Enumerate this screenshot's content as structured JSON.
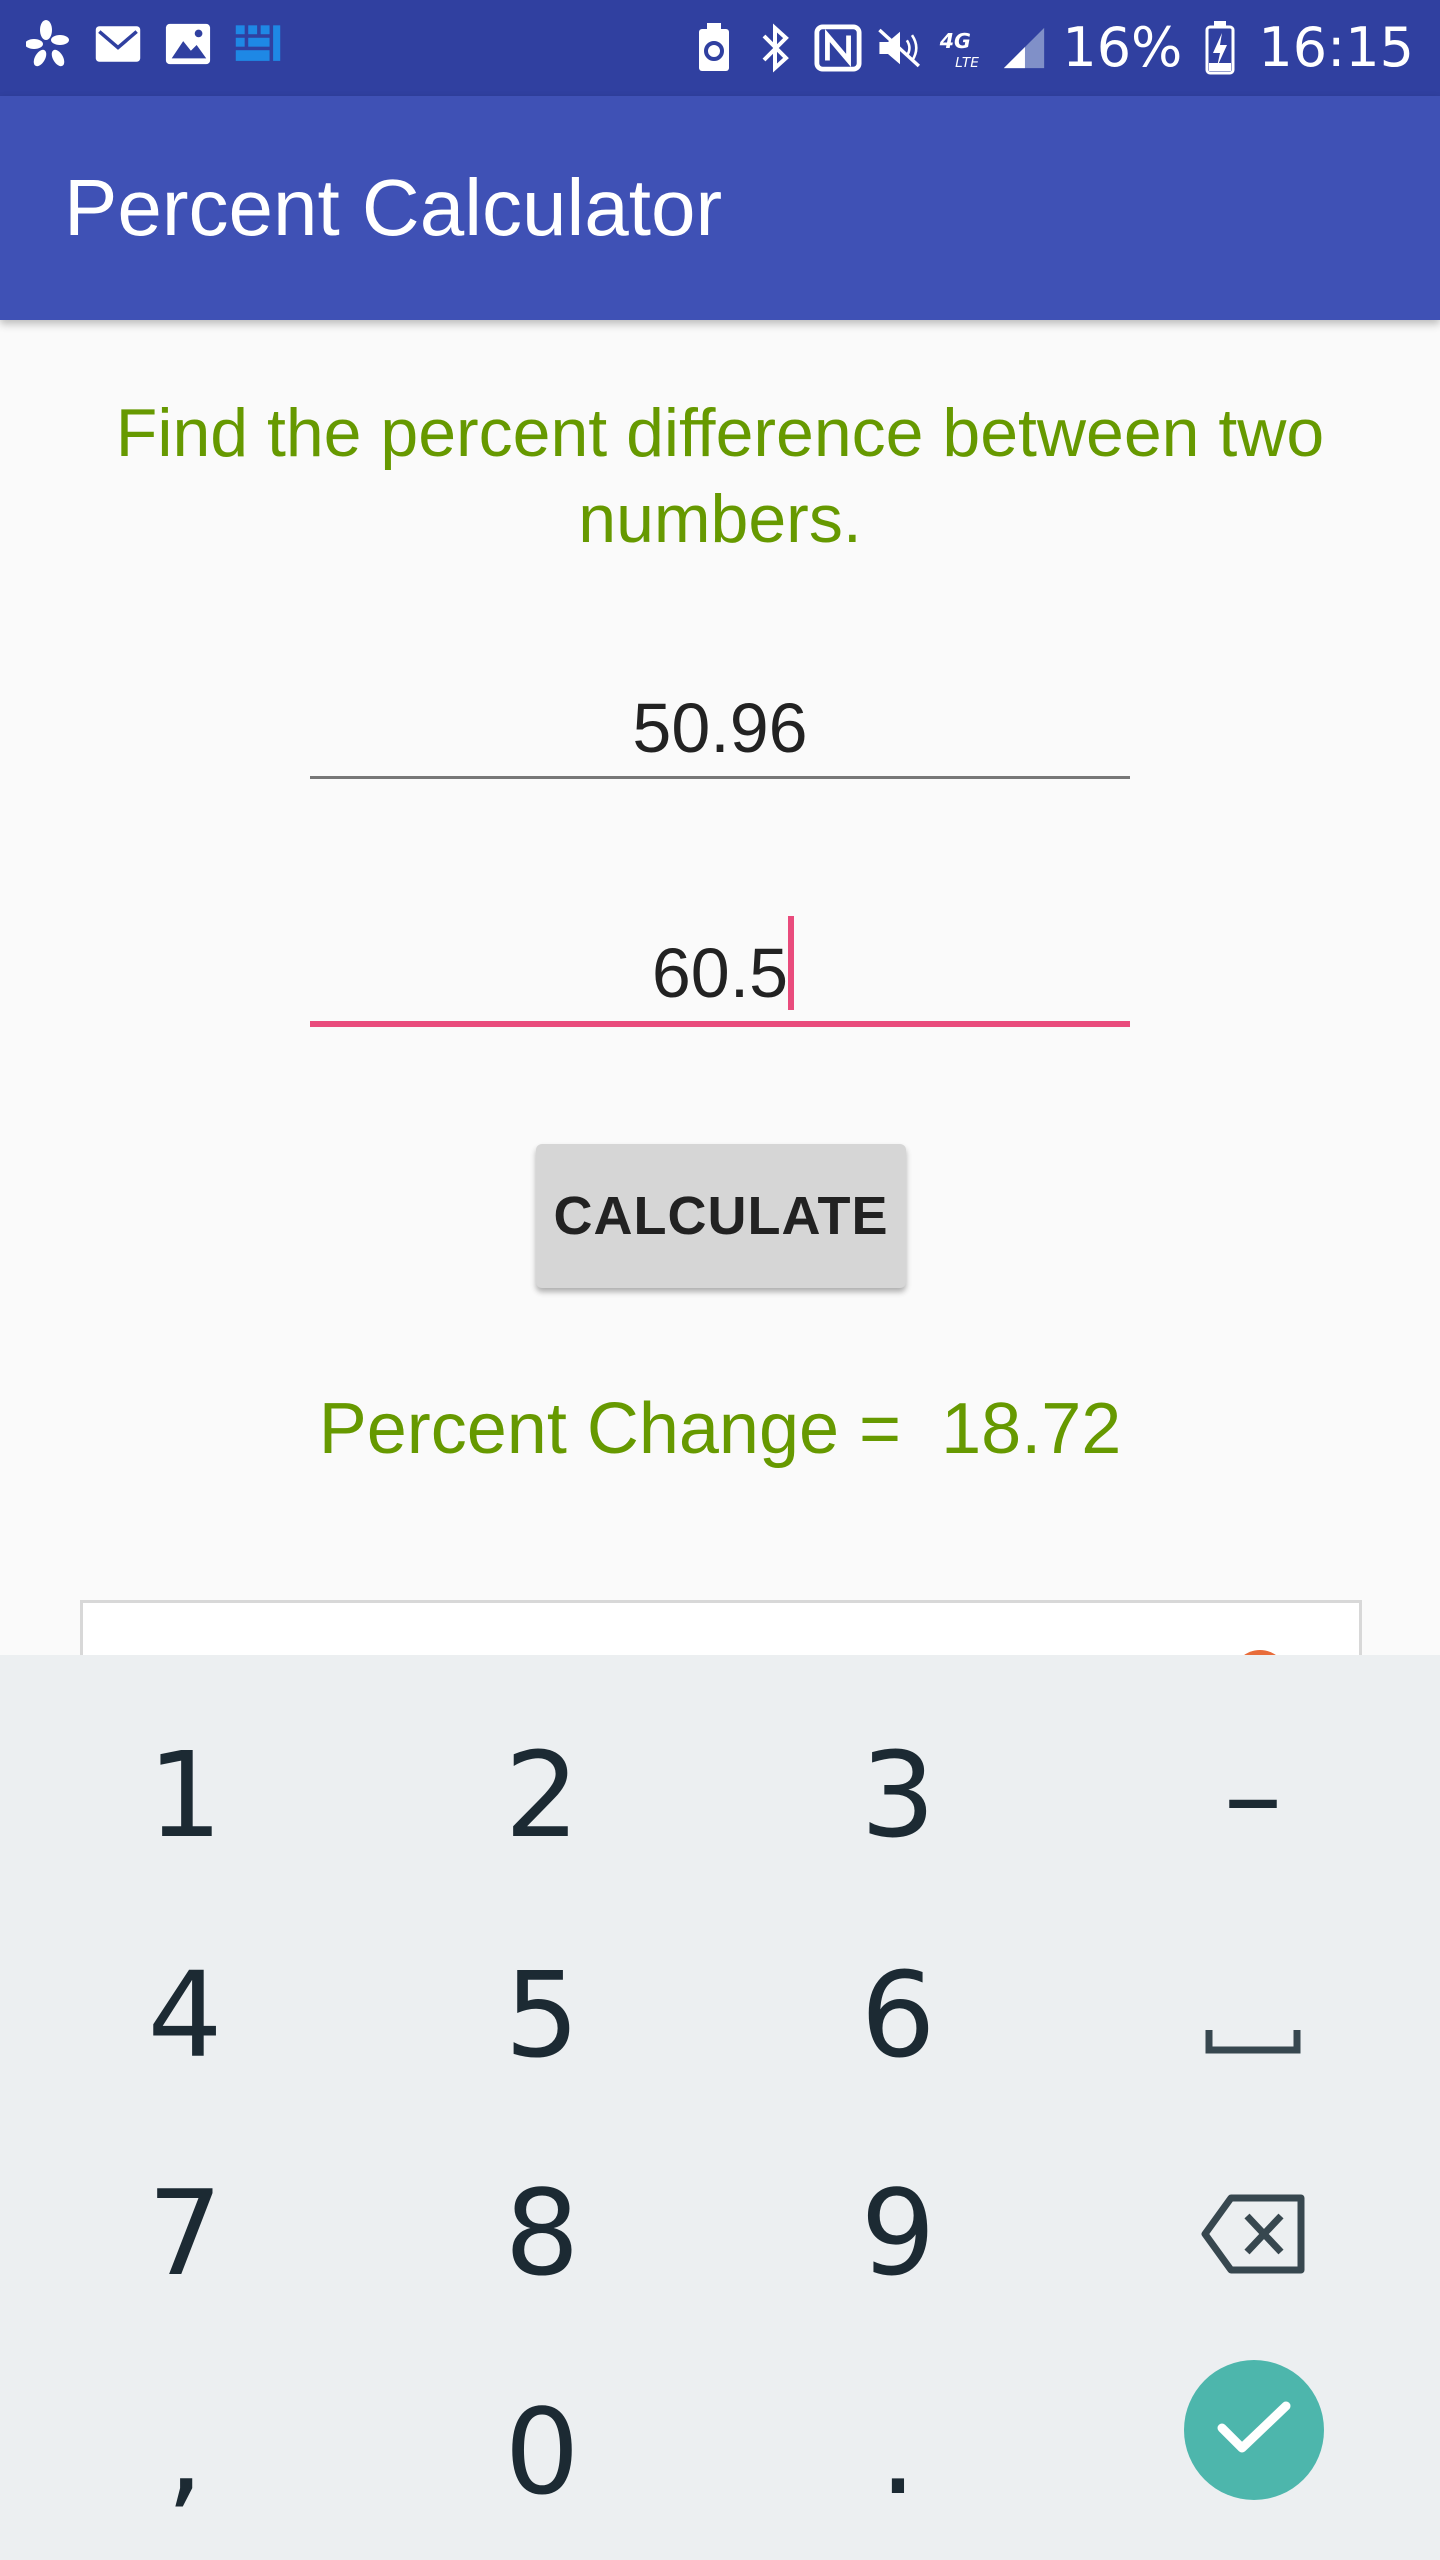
{
  "status_bar": {
    "battery_percent": "16%",
    "time": "16:15",
    "network_label": "4G LTE",
    "icons_left": [
      "yelp-icon",
      "mail-icon",
      "image-icon",
      "grid-app-icon"
    ],
    "icons_right": [
      "battery-saver-icon",
      "bluetooth-icon",
      "nfc-icon",
      "mute-icon",
      "signal-icon",
      "battery-charging-icon"
    ]
  },
  "app": {
    "title": "Percent Calculator",
    "theme_color": "#3f51b5",
    "accent_color": "#e94b7c",
    "text_accent_color": "#669900"
  },
  "main": {
    "headline": "Find the percent difference between two numbers.",
    "first_number": "50.96",
    "second_number": "60.5",
    "calculate_label": "CALCULATE",
    "result_label": "Percent Change =  18.72"
  },
  "keyboard": {
    "keys": [
      "1",
      "2",
      "3",
      "–",
      "4",
      "5",
      "6",
      "␣",
      "7",
      "8",
      "9",
      "⌫",
      ",",
      "0",
      "."
    ],
    "done_color": "#4db6ac"
  }
}
